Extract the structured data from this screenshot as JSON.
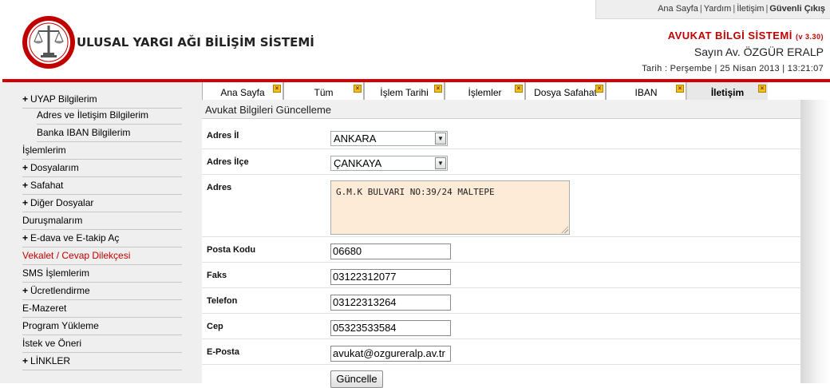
{
  "header": {
    "top_links": [
      "Ana Sayfa",
      "Yardım",
      "İletişim",
      "Güvenli Çıkış"
    ],
    "site_title": "ULUSAL YARGI AĞI BİLİŞİM SİSTEMİ",
    "system_title": "AVUKAT BİLGİ SİSTEMİ",
    "version": "(v 3.30)",
    "user_name": "Sayın Av. ÖZGÜR ERALP",
    "date_line": "Tarih : Perşembe | 25 Nisan 2013 | 13:21:07",
    "brand_color": "#d40000"
  },
  "menu": {
    "items": [
      {
        "label": "UYAP Bilgilerim",
        "expandable": true
      },
      {
        "label": "Adres ve İletişim Bilgilerim",
        "sub": true
      },
      {
        "label": "Banka IBAN Bilgilerim",
        "sub": true
      },
      {
        "label": "İşlemlerim"
      },
      {
        "label": "Dosyalarım",
        "expandable": true
      },
      {
        "label": "Safahat",
        "expandable": true
      },
      {
        "label": "Diğer Dosyalar",
        "expandable": true
      },
      {
        "label": "Duruşmalarım"
      },
      {
        "label": "E-dava ve E-takip Aç",
        "expandable": true
      },
      {
        "label": "Vekalet / Cevap Dilekçesi",
        "active": true
      },
      {
        "label": "SMS İşlemlerim"
      },
      {
        "label": "Ücretlendirme",
        "expandable": true
      },
      {
        "label": "E-Mazeret"
      },
      {
        "label": "Program Yükleme"
      },
      {
        "label": "İstek ve Öneri"
      },
      {
        "label": "LİNKLER",
        "expandable": true
      }
    ],
    "plus_symbol": "+"
  },
  "tabs": [
    {
      "label": "Ana Sayfa"
    },
    {
      "label": "Tüm"
    },
    {
      "label": "İşlem Tarihi"
    },
    {
      "label": "İşlemler"
    },
    {
      "label": "Dosya Safahat"
    },
    {
      "label": "IBAN"
    },
    {
      "label": "İletişim",
      "active": true
    }
  ],
  "form": {
    "title": "Avukat Bilgileri Güncelleme",
    "adres_il_label": "Adres İl",
    "adres_il_value": "ANKARA",
    "adres_ilce_label": "Adres İlçe",
    "adres_ilce_value": "ÇANKAYA",
    "adres_label": "Adres",
    "adres_value": "G.M.K BULVARI NO:39/24 MALTEPE",
    "posta_kodu_label": "Posta Kodu",
    "posta_kodu_value": "06680",
    "faks_label": "Faks",
    "faks_value": "03122312077",
    "telefon_label": "Telefon",
    "telefon_value": "03122313264",
    "cep_label": "Cep",
    "cep_value": "05323533584",
    "eposta_label": "E-Posta",
    "eposta_value": "avukat@ozgureralp.av.tr",
    "submit_label": "Güncelle",
    "address_bg_color": "#fdebd7"
  }
}
